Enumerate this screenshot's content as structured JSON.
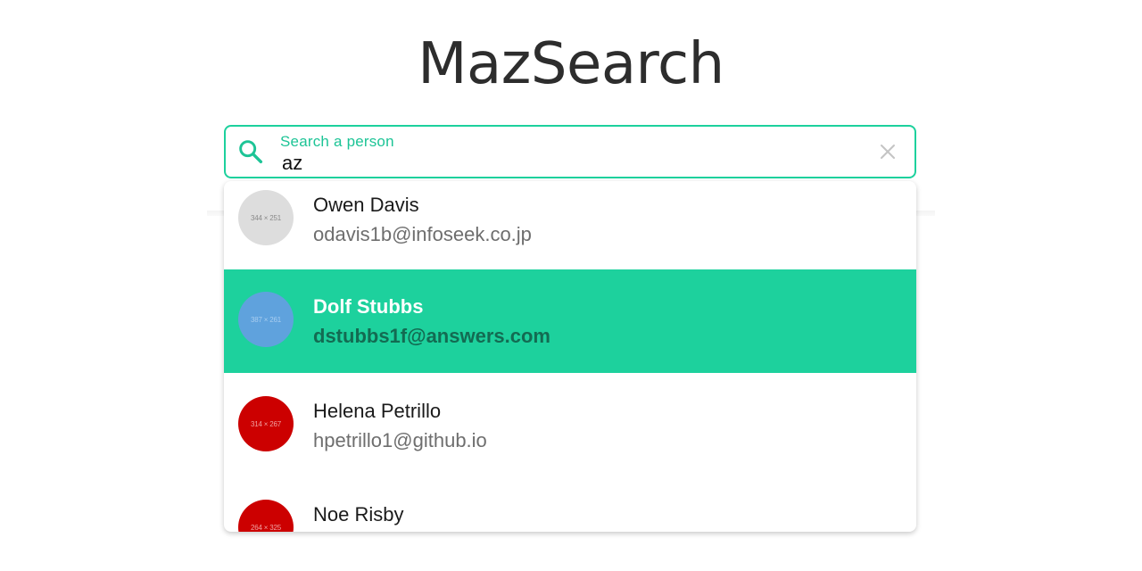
{
  "app": {
    "title": "MazSearch"
  },
  "search": {
    "label": "Search a person",
    "value": "az",
    "accent_color": "#1dd19d"
  },
  "results": [
    {
      "name": "Owen Davis",
      "email": "odavis1b@infoseek.co.jp",
      "avatar_text": "344 × 251",
      "avatar_color": "#dddddd",
      "avatar_text_color": "#8a8a8a",
      "selected": false
    },
    {
      "name": "Dolf Stubbs",
      "email": "dstubbs1f@answers.com",
      "avatar_text": "387 × 261",
      "avatar_color": "#5fa2dd",
      "avatar_text_color": "#a8cdf0",
      "selected": true
    },
    {
      "name": "Helena Petrillo",
      "email": "hpetrillo1@github.io",
      "avatar_text": "314 × 267",
      "avatar_color": "#cc0000",
      "avatar_text_color": "#f0a0a0",
      "selected": false
    },
    {
      "name": "Noe Risby",
      "email": "",
      "avatar_text": "264 × 325",
      "avatar_color": "#cc0000",
      "avatar_text_color": "#f0a0a0",
      "selected": false
    }
  ]
}
